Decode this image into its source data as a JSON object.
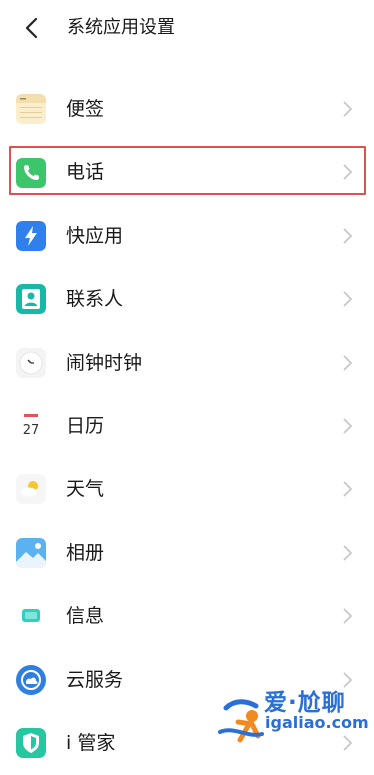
{
  "header": {
    "title": "系统应用设置"
  },
  "items": [
    {
      "label": "便签",
      "icon": "notes-icon"
    },
    {
      "label": "电话",
      "icon": "phone-icon"
    },
    {
      "label": "快应用",
      "icon": "quick-app-icon"
    },
    {
      "label": "联系人",
      "icon": "contacts-icon"
    },
    {
      "label": "闹钟时钟",
      "icon": "clock-icon"
    },
    {
      "label": "日历",
      "icon": "calendar-icon",
      "icon_text": "27"
    },
    {
      "label": "天气",
      "icon": "weather-icon"
    },
    {
      "label": "相册",
      "icon": "gallery-icon"
    },
    {
      "label": "信息",
      "icon": "messages-icon"
    },
    {
      "label": "云服务",
      "icon": "cloud-service-icon"
    },
    {
      "label": "i 管家",
      "icon": "i-manager-icon"
    }
  ],
  "watermark": {
    "line1": "爱·尬聊",
    "line2": "igaliao.com"
  },
  "colors": {
    "highlight": "#d9534f",
    "phone_green": "#3cc56a",
    "watermark_blue": "#2a6fd6"
  }
}
